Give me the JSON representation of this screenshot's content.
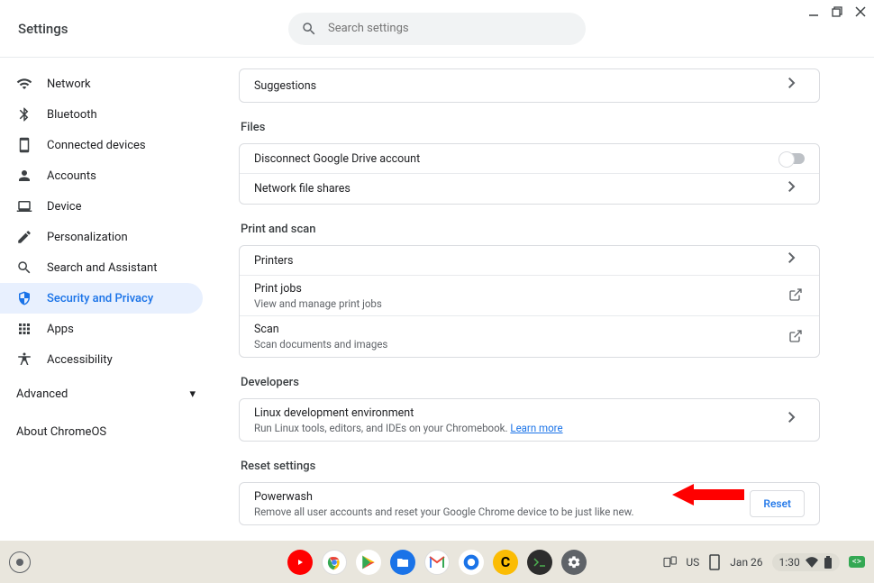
{
  "window": {
    "title": "Settings"
  },
  "search": {
    "placeholder": "Search settings"
  },
  "sidebar": {
    "items": [
      {
        "label": "Network"
      },
      {
        "label": "Bluetooth"
      },
      {
        "label": "Connected devices"
      },
      {
        "label": "Accounts"
      },
      {
        "label": "Device"
      },
      {
        "label": "Personalization"
      },
      {
        "label": "Search and Assistant"
      },
      {
        "label": "Security and Privacy"
      },
      {
        "label": "Apps"
      },
      {
        "label": "Accessibility"
      }
    ],
    "advanced": "Advanced",
    "about": "About ChromeOS"
  },
  "content": {
    "suggestions": {
      "label": "Suggestions"
    },
    "files": {
      "title": "Files",
      "disconnect": "Disconnect Google Drive account",
      "network_shares": "Network file shares"
    },
    "print_scan": {
      "title": "Print and scan",
      "printers": "Printers",
      "print_jobs": {
        "label": "Print jobs",
        "sub": "View and manage print jobs"
      },
      "scan": {
        "label": "Scan",
        "sub": "Scan documents and images"
      }
    },
    "developers": {
      "title": "Developers",
      "linux": {
        "label": "Linux development environment",
        "sub": "Run Linux tools, editors, and IDEs on your Chromebook. ",
        "link": "Learn more"
      }
    },
    "reset": {
      "title": "Reset settings",
      "powerwash": {
        "label": "Powerwash",
        "sub": "Remove all user accounts and reset your Google Chrome device to be just like new.",
        "button": "Reset"
      }
    }
  },
  "shelf": {
    "keyboard_layout": "US",
    "date": "Jan 26",
    "time": "1:30"
  }
}
